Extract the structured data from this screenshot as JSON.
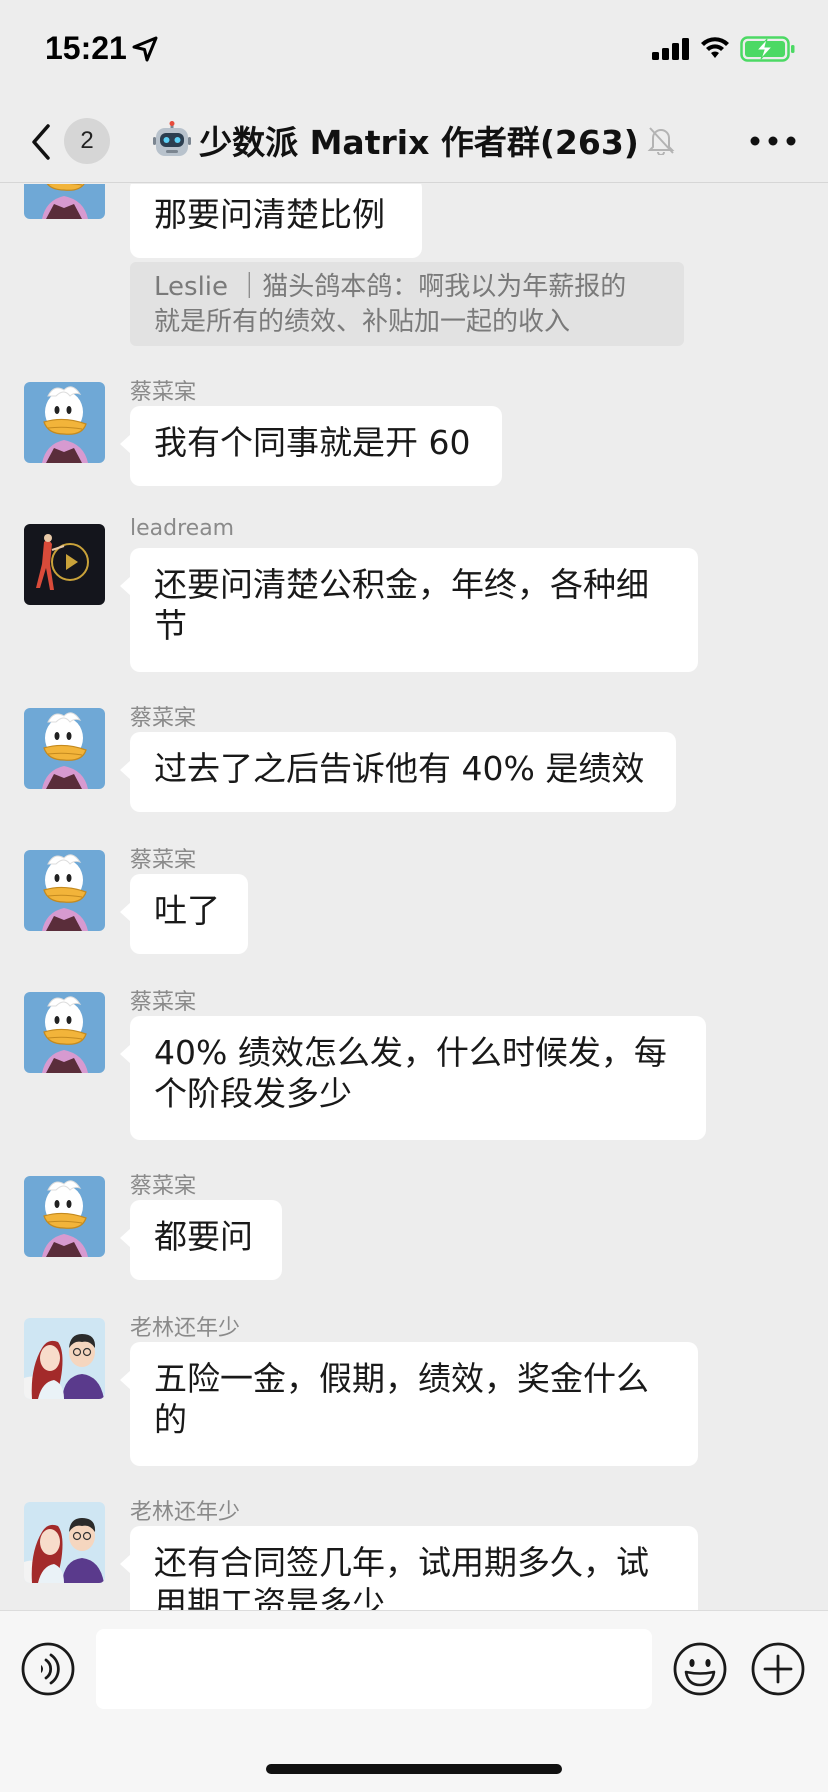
{
  "status_bar": {
    "time": "15:21",
    "icons": [
      "location-arrow-icon",
      "cellular-signal-icon",
      "wifi-icon",
      "battery-charging-icon"
    ]
  },
  "nav": {
    "back_icon": "chevron-left-icon",
    "unread_count": "2",
    "title_emoji_icon": "robot-icon",
    "title": "少数派 Matrix 作者群(263)",
    "mute_icon": "bell-slash-icon",
    "more_icon": "more-dots-icon"
  },
  "messages": [
    {
      "sender": "",
      "text": "那要问清楚比例",
      "quote": "Leslie ｜猫头鸽本鸽：啊我以为年薪报的就是所有的绩效、补贴加一起的收入",
      "quote_lines": [
        "Leslie ｜猫头鸽本鸽：啊我以为年薪报的",
        "就是所有的绩效、补贴加一起的收入"
      ]
    },
    {
      "sender": "蔡菜宲",
      "text": "我有个同事就是开 60"
    },
    {
      "sender": "leadream",
      "text_lines": [
        "还要问清楚公积金，年终，各种细",
        "节"
      ]
    },
    {
      "sender": "蔡菜宲",
      "text": "过去了之后告诉他有 40% 是绩效"
    },
    {
      "sender": "蔡菜宲",
      "text": "吐了"
    },
    {
      "sender": "蔡菜宲",
      "text_lines": [
        "40% 绩效怎么发，什么时候发，每",
        "个阶段发多少"
      ]
    },
    {
      "sender": "蔡菜宲",
      "text": "都要问"
    },
    {
      "sender": "老林还年少",
      "text_lines": [
        "五险一金，假期，绩效，奖金什么",
        "的"
      ]
    },
    {
      "sender": "老林还年少",
      "text_lines": [
        "还有合同签几年，试用期多久，试",
        "用期工资是多少"
      ]
    }
  ],
  "input_bar": {
    "voice_icon": "voice-icon",
    "input_value": "",
    "emoji_icon": "emoji-smile-icon",
    "plus_icon": "plus-circle-icon"
  },
  "colors": {
    "background": "#ededed",
    "bubble": "#ffffff",
    "quote_bg": "#e2e2e2",
    "battery_green": "#4cd964"
  }
}
